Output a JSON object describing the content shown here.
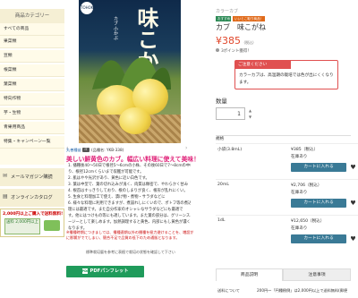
{
  "sidebar": {
    "heading": "商品カテゴリー",
    "items": [
      "すべての商品",
      "果菜類",
      "豆類",
      "根菜類",
      "葉菜類",
      "特向作物",
      "芋・生物",
      "青果用商品",
      "特集・キャンペーン一覧"
    ],
    "links": [
      "メールマガジン購読",
      "オンラインカタログ"
    ],
    "banner_top": "2,000円以上ご購入で送料無料!",
    "banner_mid": "送料 2,000円以上"
  },
  "product_image": {
    "title": "味こかね",
    "subtitle": "カブ 小かぶ",
    "logo": "TOHOKU"
  },
  "maker": {
    "brand": "丸善種苗",
    "badge": "IT",
    "code": "(品種名: YKB-338)"
  },
  "description": {
    "catch": "美しい鮮黄色のカブ。幅広い料理に使えて美味！",
    "lines": [
      "1. 播種後40～50日で根径5～6cmの小株、その後60日で7～8cmの中株とな",
      "り、根径12cmくらいまで収穫が可能です。",
      "2. 肌はやや光沢があり、黄色に近い白色です。",
      "3. 葉は中型で、葉の切れ込みが浅く、肉質は緻密で、やわらかく甘み",
      "4. 根首はすっきりしており、根のしまりが良く、根形が乱れにくい。",
      "5. 生食と料理加工で使え、漬け物・煮物・サラダなどに",
      "6. 様々な料理に利用できますが、煮崩れしにくいので、ポトフ等の煮込み料",
      "理には最適です。また自分作家のオシャレなサラダなどにも最適で",
      "す。他にはつけもの等にも適しています。また葉の部分は、グリーンスム",
      "ージーとして楽しめます。加熱調理すると黄色、内部にもし黄色が濃く",
      "なります。"
    ],
    "note_red": [
      "※播種時期につきましては、播種適期以外の播種を極力避けることを、増設が",
      "に影響がでてしまい、競合不足で品質の低下のため通販となります。"
    ],
    "note_grey": "標準栽培暦を参考に表植で栽培の状態を確認して下さい",
    "pdf_label": "PDFパンフレット",
    "pdf_icon": "PDF"
  },
  "product": {
    "category": "カラーカブ",
    "badge_new": "おすすめ",
    "badge_promo": "いいとこ取り商品！",
    "name": "カブ　味こがね",
    "price": "¥385",
    "price_tax": "(税込)",
    "points": "3ポイント獲得！",
    "caution_head": "ご注意ください",
    "caution_body": "カラーカブは、高温期の栽培では色が出にくくなります。",
    "qty_label": "数量",
    "qty_value": "1",
    "spec_label": "規格",
    "variants": [
      {
        "name": "小袋(3.8mL)",
        "price": "¥385（税込）",
        "stock": "在庫あり",
        "cart": "カートに入れる"
      },
      {
        "name": "20mL",
        "price": "¥2,706（税込）",
        "stock": "在庫あり",
        "cart": "カートに入れる"
      },
      {
        "name": "1dL",
        "price": "¥12,650（税込）",
        "stock": "在庫あり",
        "cart": "カートに入れる"
      }
    ],
    "tabs": [
      "商品説明",
      "注意事項"
    ],
    "ship_label": "送料について",
    "ship_value": "200円～「円種樹倒」は2,000円以上で送料無料(郵便"
  },
  "colors": {
    "accent_price": "#e0462a",
    "cart_button": "#3a7a96",
    "pdf_button": "#1f9b5b",
    "catch_pink": "#e0257a",
    "caution_red": "#e05050",
    "sidebar_bg": "#fffbe9"
  },
  "icons": {
    "mail": "mail-icon",
    "catalog": "book-icon",
    "heart": "heart-icon"
  }
}
